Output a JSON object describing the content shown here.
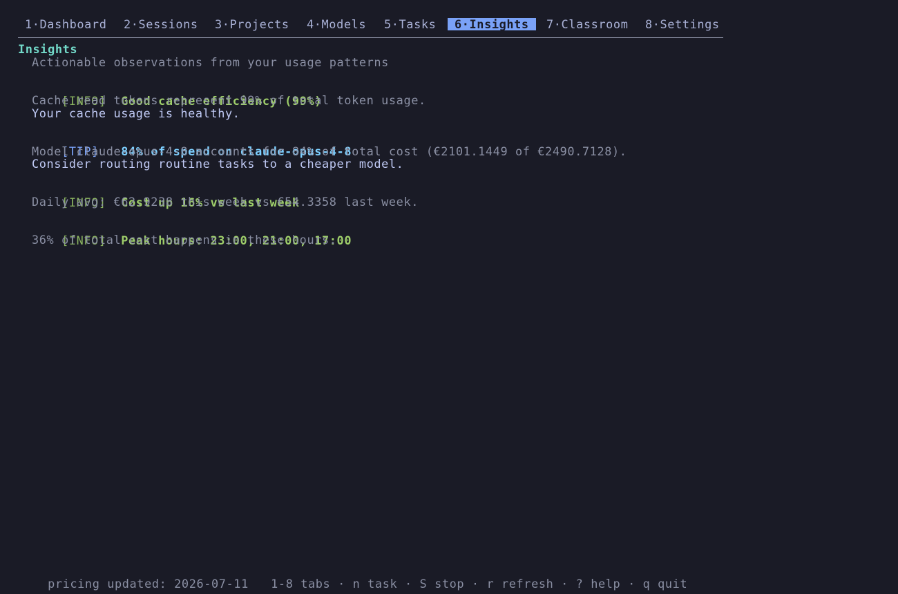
{
  "tabs": [
    {
      "label": "1·Dashboard"
    },
    {
      "label": "2·Sessions"
    },
    {
      "label": "3·Projects"
    },
    {
      "label": "4·Models"
    },
    {
      "label": "5·Tasks"
    },
    {
      "label": "6·Insights"
    },
    {
      "label": "7·Classroom"
    },
    {
      "label": "8·Settings"
    }
  ],
  "active_tab": "6·Insights",
  "page": {
    "title": "Insights",
    "subtitle": "Actionable observations from your usage patterns"
  },
  "insights": [
    {
      "tag": "[INFO]",
      "title": "Good cache efficiency (99%)",
      "detail": "Cache read tokens represent 99% of total token usage.",
      "advice": "Your cache usage is healthy."
    },
    {
      "tag": "[TIP]",
      "title": "84% of spend on claude-opus-4-8",
      "detail": "Model claude-opus-4-8 accounts for 84% of total cost (€2101.1449 of €2490.7128).",
      "advice": "Consider routing routine tasks to a cheaper model."
    },
    {
      "tag": "[INFO]",
      "title": "Cost up 16% vs last week",
      "detail": "Daily avg: €62.9238 this week vs €54.3358 last week."
    },
    {
      "tag": "[INFO]",
      "title": "Peak hours: 23:00, 21:00, 17:00",
      "detail": "36% of total cost happens in these hours."
    }
  ],
  "footer": {
    "pricing": "pricing updated: 2026-07-11",
    "keys": "1-8 tabs · n task · S stop · r refresh · ? help · q quit"
  },
  "colors": {
    "background": "#1a1b26",
    "active_tab": "#7aa2f7",
    "heading": "#73daca",
    "info": "#9ece6a",
    "tip": "#7dcfff"
  }
}
